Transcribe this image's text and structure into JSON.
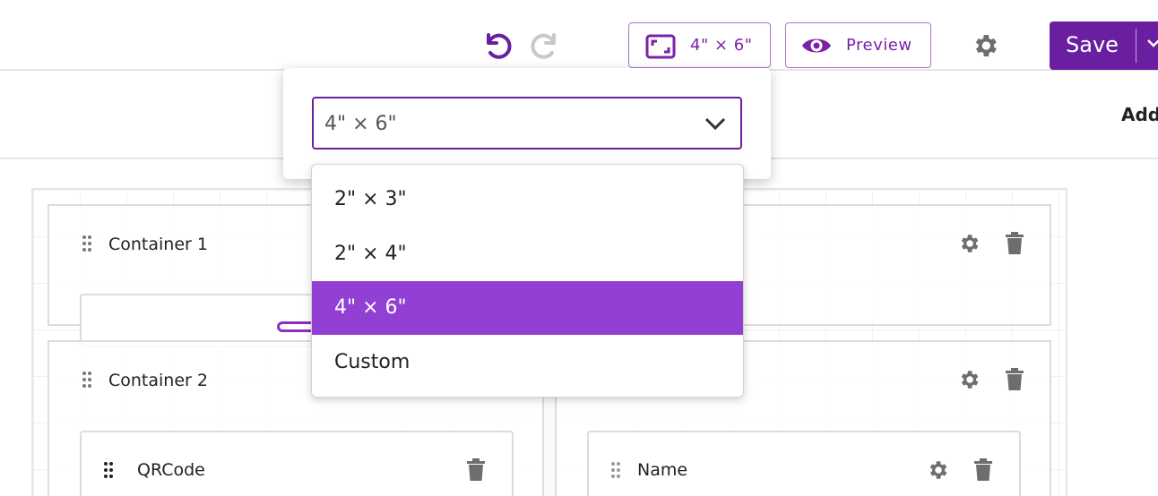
{
  "toolbar": {
    "size_label": "4\" × 6\"",
    "preview_label": "Preview",
    "save_label": "Save",
    "accent_color": "#6a1fa0",
    "icons": [
      "undo-icon",
      "redo-icon",
      "resize-icon",
      "eye-icon",
      "gear-icon",
      "chevron-down-icon"
    ]
  },
  "subbar": {
    "add_label": "Add"
  },
  "size_dropdown": {
    "selected": "4\" × 6\"",
    "options": [
      "2\" × 3\"",
      "2\" × 4\"",
      "4\" × 6\"",
      "Custom"
    ],
    "highlight_color": "#9140d3"
  },
  "containers": [
    {
      "title": "Container 1"
    },
    {
      "title": "Container 2",
      "cards": [
        {
          "title": "QRCode"
        },
        {
          "title": "Name"
        }
      ]
    }
  ]
}
